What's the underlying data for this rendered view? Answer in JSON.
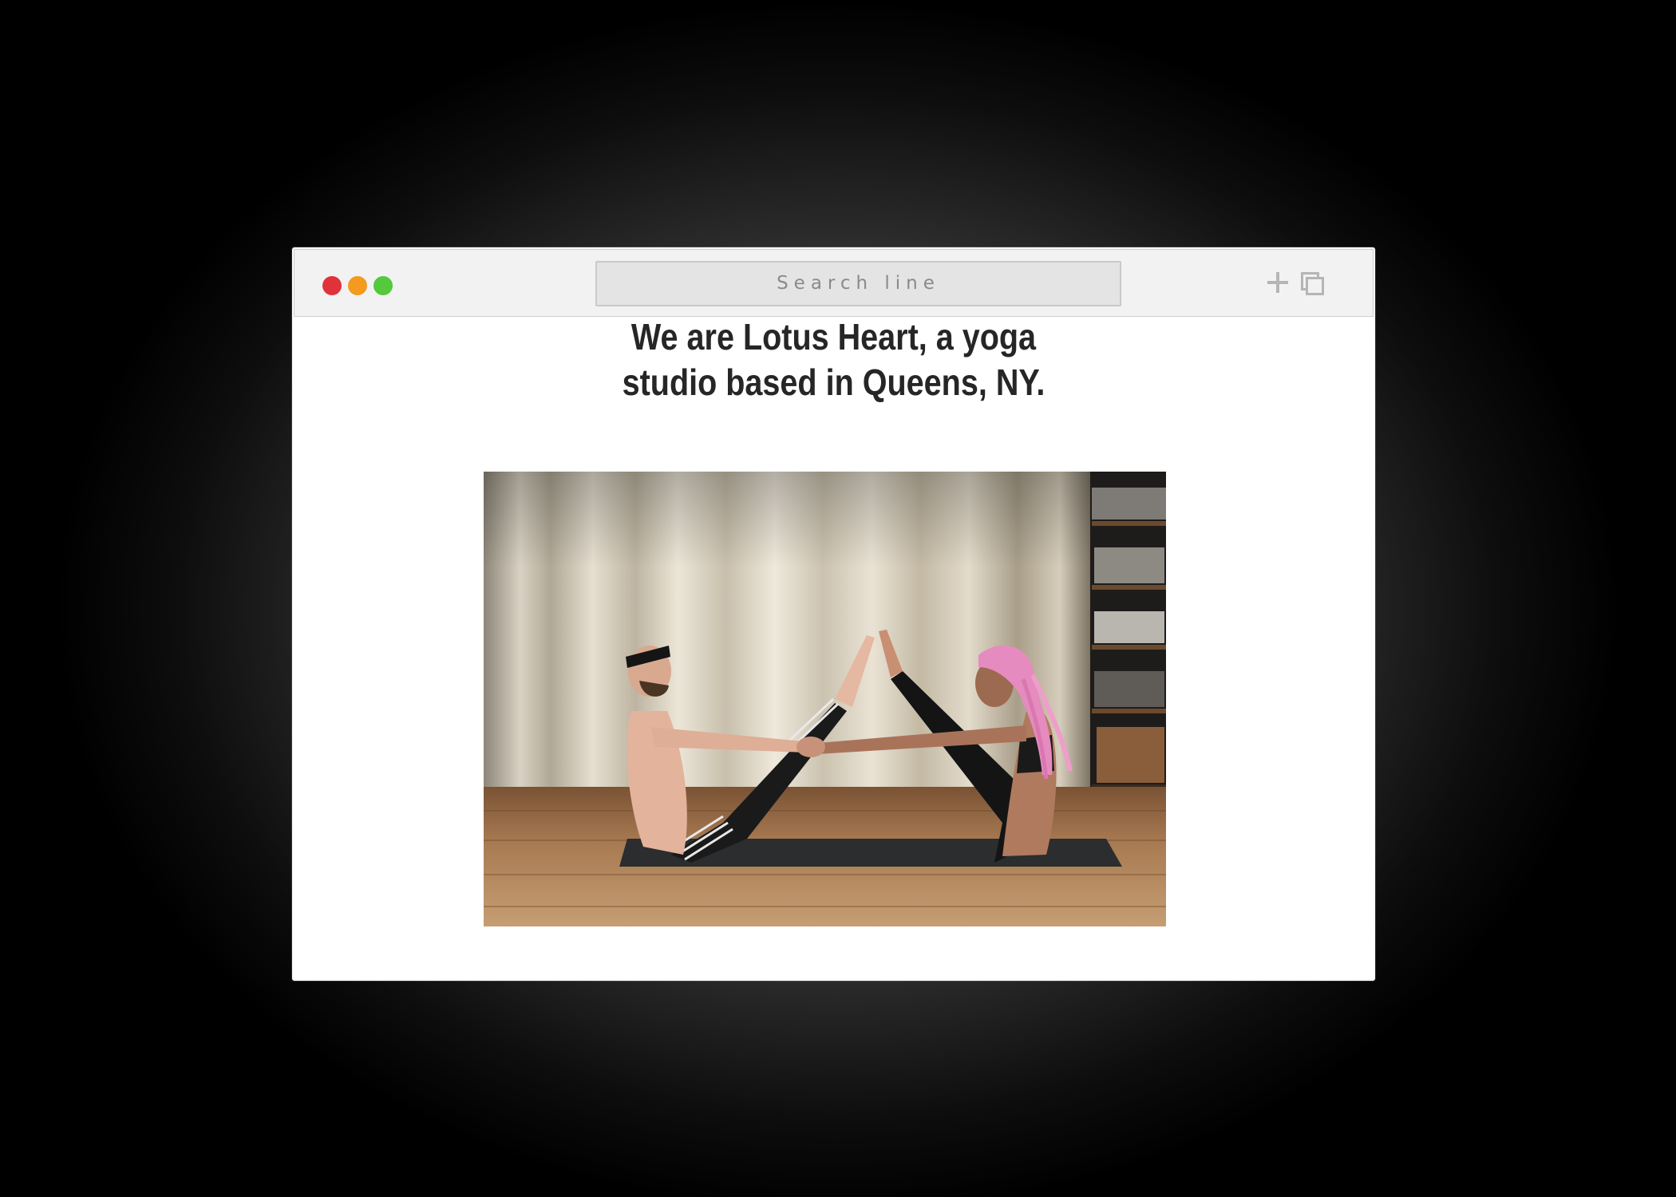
{
  "browser": {
    "search_placeholder": "Search line",
    "toolbar_icons": [
      "plus-icon",
      "tabs-icon"
    ],
    "traffic_lights": {
      "close_color": "#e0323a",
      "minimize_color": "#f39a1f",
      "maximize_color": "#53c93b"
    }
  },
  "page": {
    "headline_line1": "We are Lotus Heart, a yoga",
    "headline_line2": "studio based in Queens, NY.",
    "hero_image_subject": "two people doing partner boat pose on a yoga mat in a studio"
  },
  "colors": {
    "headline_text": "#262626",
    "page_background": "#ffffff",
    "titlebar_background": "#f2f2f2"
  }
}
